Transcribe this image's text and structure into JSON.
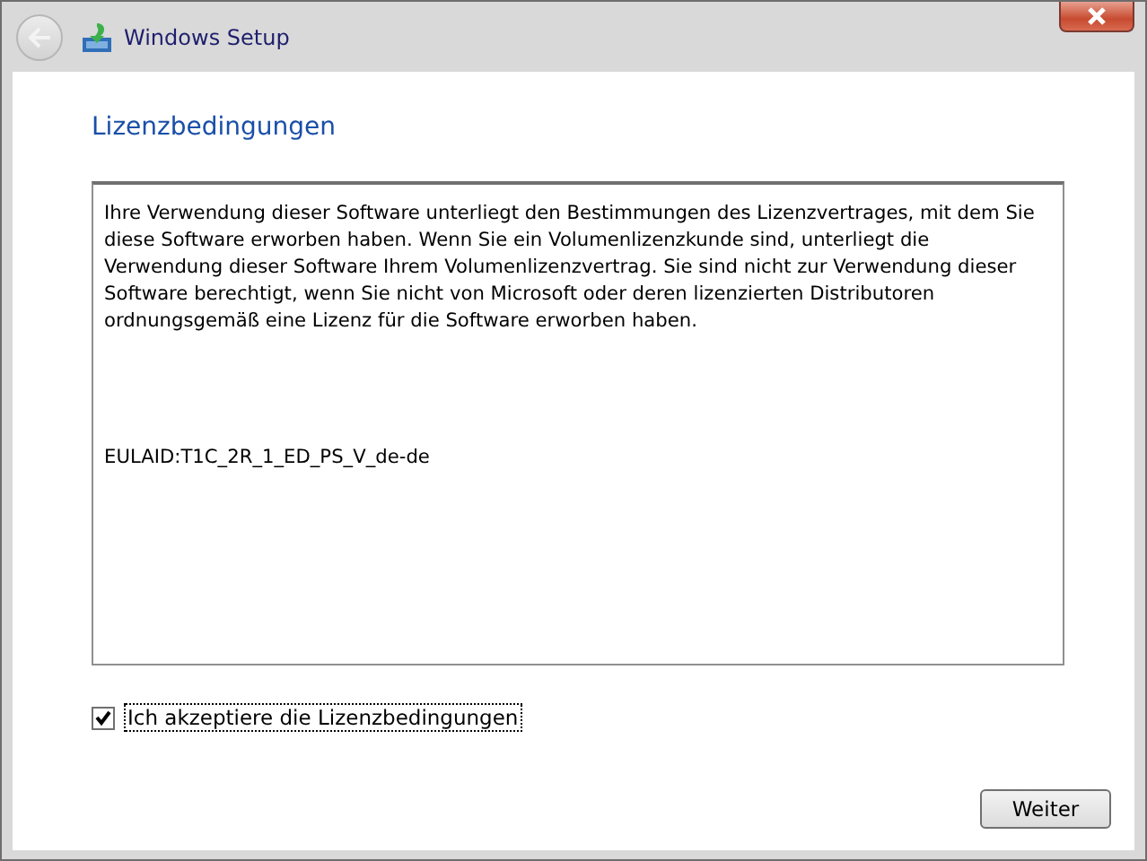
{
  "window": {
    "title": "Windows Setup",
    "back_button": {
      "disabled": true
    }
  },
  "heading": "Lizenzbedingungen",
  "license_text": {
    "paragraph": "Ihre Verwendung dieser Software unterliegt den Bestimmungen des Lizenzvertrages, mit dem Sie diese Software erworben haben. Wenn Sie ein Volumenlizenzkunde sind, unterliegt die Verwendung dieser Software Ihrem Volumenlizenzvertrag. Sie sind nicht zur Verwendung dieser Software berechtigt, wenn Sie nicht von Microsoft oder deren lizenzierten Distributoren ordnungsgemäß eine Lizenz für die Software erworben haben.",
    "eula_id": "EULAID:T1C_2R_1_ED_PS_V_de-de"
  },
  "accept_checkbox": {
    "label": "Ich akzeptiere die Lizenzbedingungen",
    "checked": true
  },
  "buttons": [
    {
      "label": "Weiter"
    }
  ]
}
